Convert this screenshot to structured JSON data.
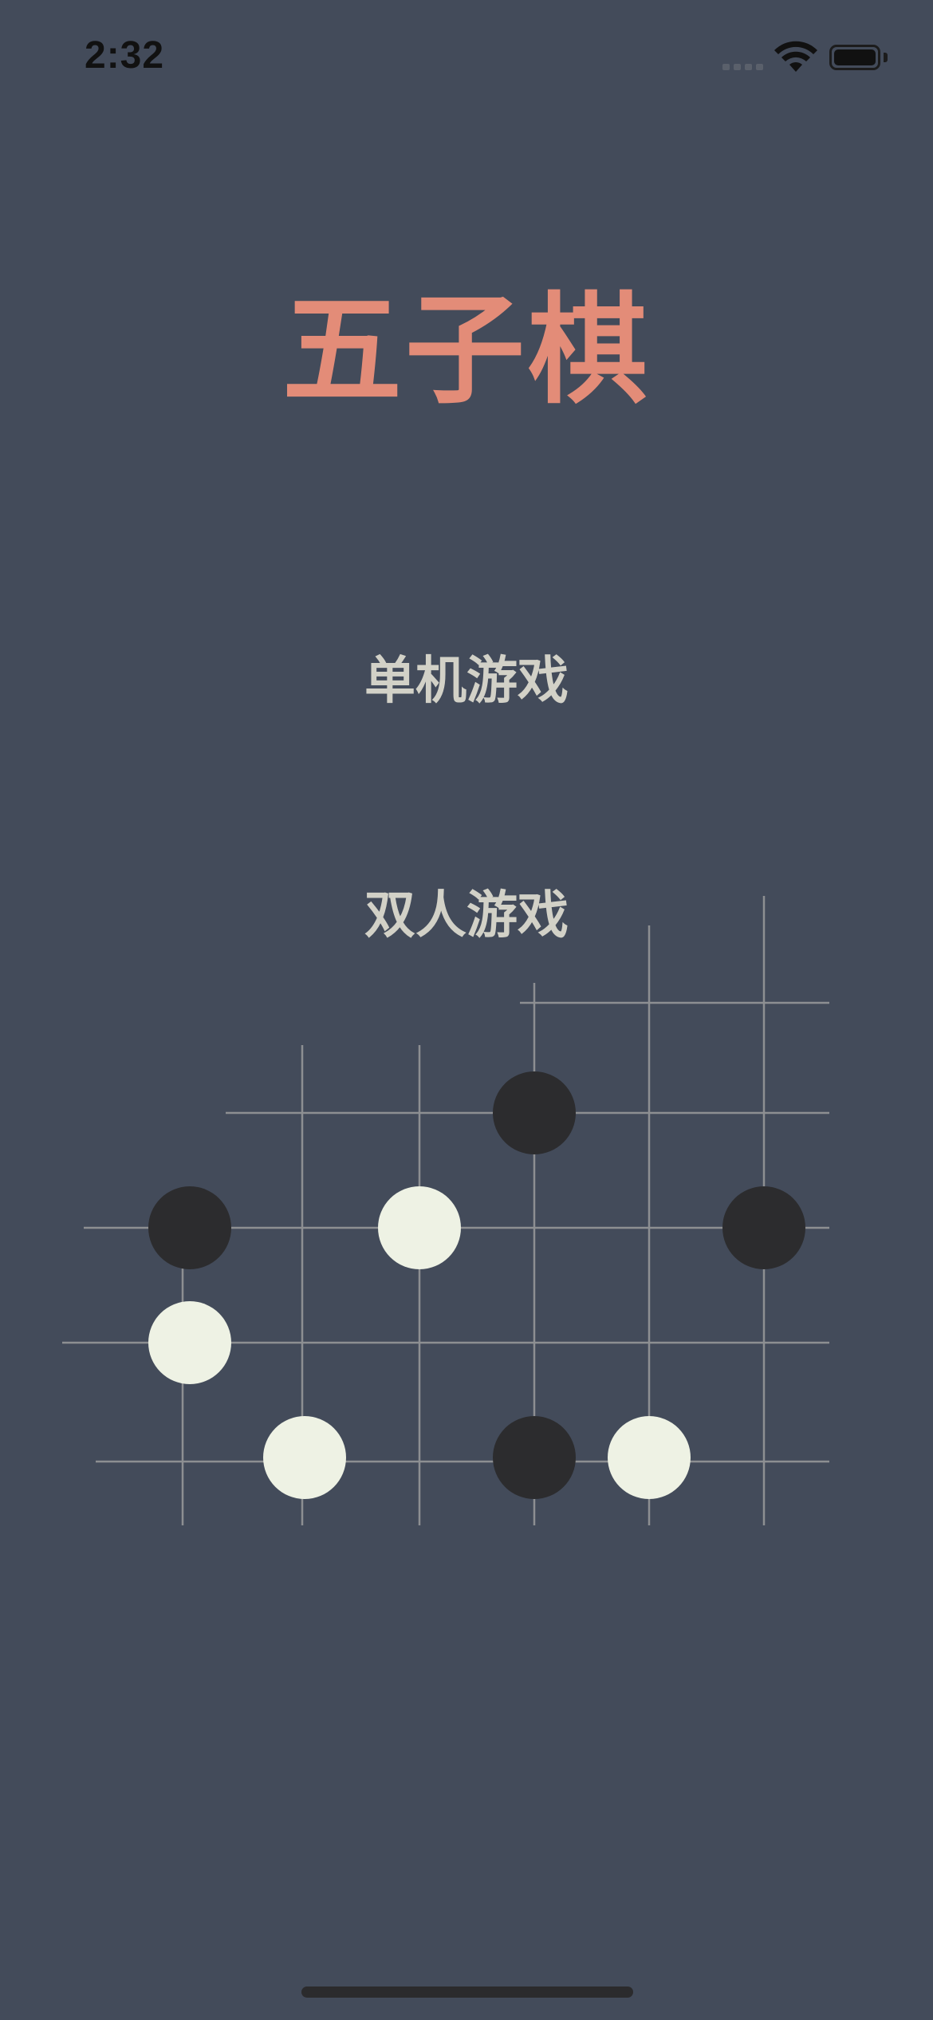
{
  "status_bar": {
    "time": "2:32",
    "battery_level": 1.0
  },
  "title": "五子棋",
  "menu": {
    "single_player_label": "单机游戏",
    "two_player_label": "双人游戏"
  },
  "board": {
    "line_color": "#8d8f92",
    "black_stone_color": "#2c2c2e",
    "white_stone_color": "#eef2e4",
    "stones": [
      {
        "color": "black",
        "col": 5,
        "row": 2
      },
      {
        "color": "black",
        "col": 1,
        "row": 3
      },
      {
        "color": "white",
        "col": 3,
        "row": 3
      },
      {
        "color": "black",
        "col": 7,
        "row": 3
      },
      {
        "color": "white",
        "col": 1,
        "row": 4
      },
      {
        "color": "white",
        "col": 2,
        "row": 5
      },
      {
        "color": "black",
        "col": 5,
        "row": 5
      },
      {
        "color": "white",
        "col": 6,
        "row": 5
      }
    ]
  },
  "colors": {
    "background": "#434b5a",
    "title": "#e38c78",
    "menu_text": "#d2d1c7"
  }
}
